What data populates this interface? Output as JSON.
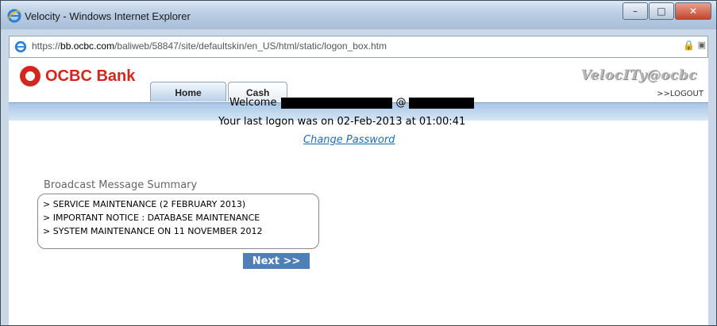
{
  "window": {
    "title": "Velocity - Windows Internet Explorer",
    "minimize": "–",
    "maximize": "□",
    "close": "✕"
  },
  "address": {
    "scheme": "https://",
    "host": "bb.ocbc.com",
    "path": "/baliweb/58847/site/defaultskin/en_US/html/static/logon_box.htm"
  },
  "header": {
    "logo_text": "OCBC Bank",
    "brand": "VelocITy@ocbc",
    "logout": ">>LOGOUT",
    "tabs": [
      {
        "label": "Home",
        "active": true
      },
      {
        "label": "Cash",
        "active": false
      }
    ]
  },
  "welcome": {
    "greeting": "Welcome",
    "at": "@",
    "last_logon_prefix": "Your last logon was on",
    "last_logon_date": "02-Feb-2013",
    "last_logon_at": "at",
    "last_logon_time": "01:00:41",
    "change_password": "Change Password"
  },
  "broadcast": {
    "title": "Broadcast Message Summary",
    "items": [
      "> SERVICE MAINTENANCE (2 FEBRUARY 2013)",
      "> IMPORTANT NOTICE : DATABASE MAINTENANCE",
      "> SYSTEM MAINTENANCE ON 11 NOVEMBER 2012"
    ],
    "next": "Next >>"
  },
  "colors": {
    "brand_red": "#d3261f",
    "link_blue": "#1f6fb5",
    "button_blue": "#4f7fb7"
  }
}
